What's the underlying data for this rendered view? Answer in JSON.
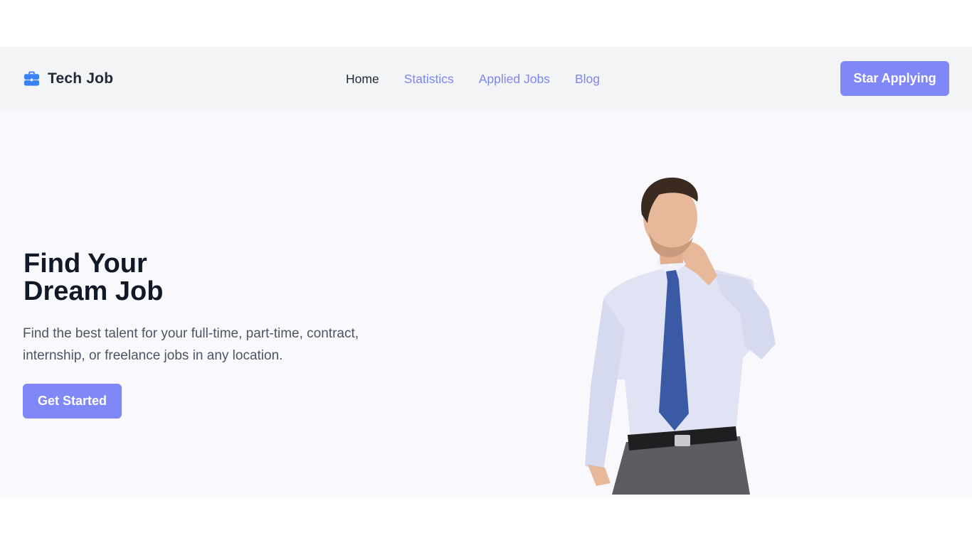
{
  "brand": {
    "name": "Tech Job",
    "icon": "briefcase-icon"
  },
  "nav": {
    "links": [
      {
        "label": "Home",
        "active": true
      },
      {
        "label": "Statistics",
        "active": false
      },
      {
        "label": "Applied Jobs",
        "active": false
      },
      {
        "label": "Blog",
        "active": false
      }
    ],
    "cta_label": "Star Applying"
  },
  "hero": {
    "title": "Find Your\nDream Job",
    "description": "Find the best talent for your full-time, part-time, contract, internship, or freelance jobs in any location.",
    "button_label": "Get Started"
  },
  "colors": {
    "accent": "#8088f8",
    "nav_link": "#7e86f0",
    "navbar_bg": "#f3f4f6",
    "hero_bg": "#f9f9fd",
    "heading": "#111827",
    "brand_icon": "#3b82f6"
  }
}
